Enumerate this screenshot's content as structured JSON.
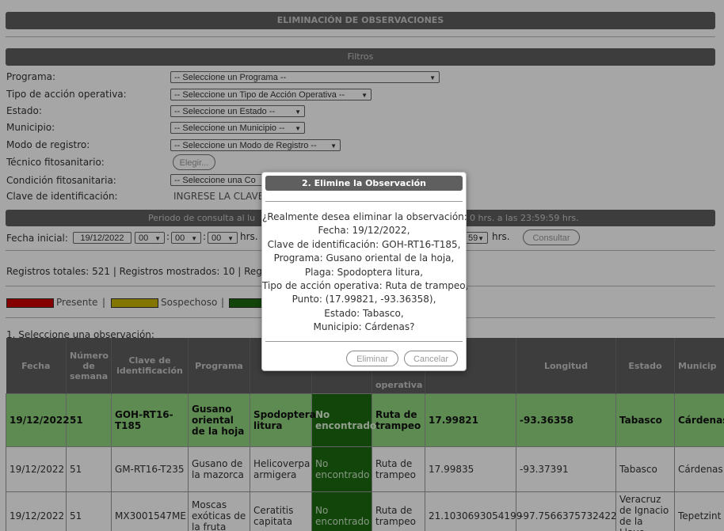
{
  "main_title": "ELIMINACIÓN DE OBSERVACIONES",
  "filters": {
    "title": "Filtros",
    "programa_label": "Programa:",
    "programa_value": "-- Seleccione un Programa --",
    "tipo_label": "Tipo de acción operativa:",
    "tipo_value": "-- Seleccione un Tipo de Acción Operativa --",
    "estado_label": "Estado:",
    "estado_value": "-- Seleccione un Estado --",
    "municipio_label": "Municipio:",
    "municipio_value": "-- Seleccione un Municipio --",
    "modo_label": "Modo de registro:",
    "modo_value": "-- Seleccione un Modo de Registro --",
    "tecnico_label": "Técnico fitosanitario:",
    "tecnico_button": "Elegir...",
    "condicion_label": "Condición fitosanitaria:",
    "condicion_value": "-- Seleccione una Co",
    "clave_label": "Clave de identificación:",
    "clave_placeholder": "INGRESE LA CLAVE"
  },
  "period": {
    "title_left": "Periodo de consulta al lu",
    "title_right": "0 hrs. a las 23:59:59 hrs.",
    "fecha_inicial_label": "Fecha inicial:",
    "fecha_inicial_value": "19/12/2022",
    "hour_value": "00",
    "min_value": "00",
    "sec_value": "00",
    "hrs_label": "hrs.",
    "end_sec_value": "59",
    "end_hrs_label": "hrs.",
    "consultar_button": "Consultar"
  },
  "stats": {
    "text": "Registros totales: 521 | Registros mostrados: 10 | Regis"
  },
  "legend": {
    "presente": "Presente",
    "sospechoso": "Sospechoso",
    "sep": "|",
    "colors": {
      "presente": "#cc0000",
      "sospechoso": "#c8b400",
      "ausente": "#1d6b10"
    }
  },
  "select_prompt": "1. Seleccione una observación:",
  "table": {
    "headers": [
      "Fecha",
      "Número de semana",
      "Clave de identificación",
      "Programa",
      "",
      "",
      "operativa",
      "itud",
      "Longitud",
      "Estado",
      "Municip"
    ],
    "rows": [
      [
        "19/12/2022",
        "51",
        "GOH-RT16-T185",
        "Gusano oriental de la hoja",
        "Spodoptera litura",
        "No encontrado",
        "Ruta de trampeo",
        "17.99821",
        "-93.36358",
        "Tabasco",
        "Cárdenas"
      ],
      [
        "19/12/2022",
        "51",
        "GM-RT16-T235",
        "Gusano de la mazorca",
        "Helicoverpa armigera",
        "No encontrado",
        "Ruta de trampeo",
        "17.99835",
        "-93.37391",
        "Tabasco",
        "Cárdenas"
      ],
      [
        "19/12/2022",
        "51",
        "MX3001547ME",
        "Moscas exóticas de la fruta",
        "Ceratitis capitata",
        "No encontrado",
        "Ruta de trampeo",
        "21.1030693054199",
        "-97.7566375732422",
        "Veracruz de Ignacio de la Llave",
        "Tepetzint"
      ]
    ]
  },
  "modal": {
    "title": "2. Elimine la Observación",
    "lines": [
      "¿Realmente desea eliminar la observación:",
      "Fecha: 19/12/2022,",
      "Clave de identificación: GOH-RT16-T185,",
      "Programa: Gusano oriental de la hoja,",
      "Plaga: Spodoptera litura,",
      "Tipo de acción operativa: Ruta de trampeo,",
      "Punto: (17.99821, -93.36358),",
      "Estado: Tabasco,",
      "Municipio: Cárdenas?"
    ],
    "eliminar_button": "Eliminar",
    "cancelar_button": "Cancelar"
  }
}
